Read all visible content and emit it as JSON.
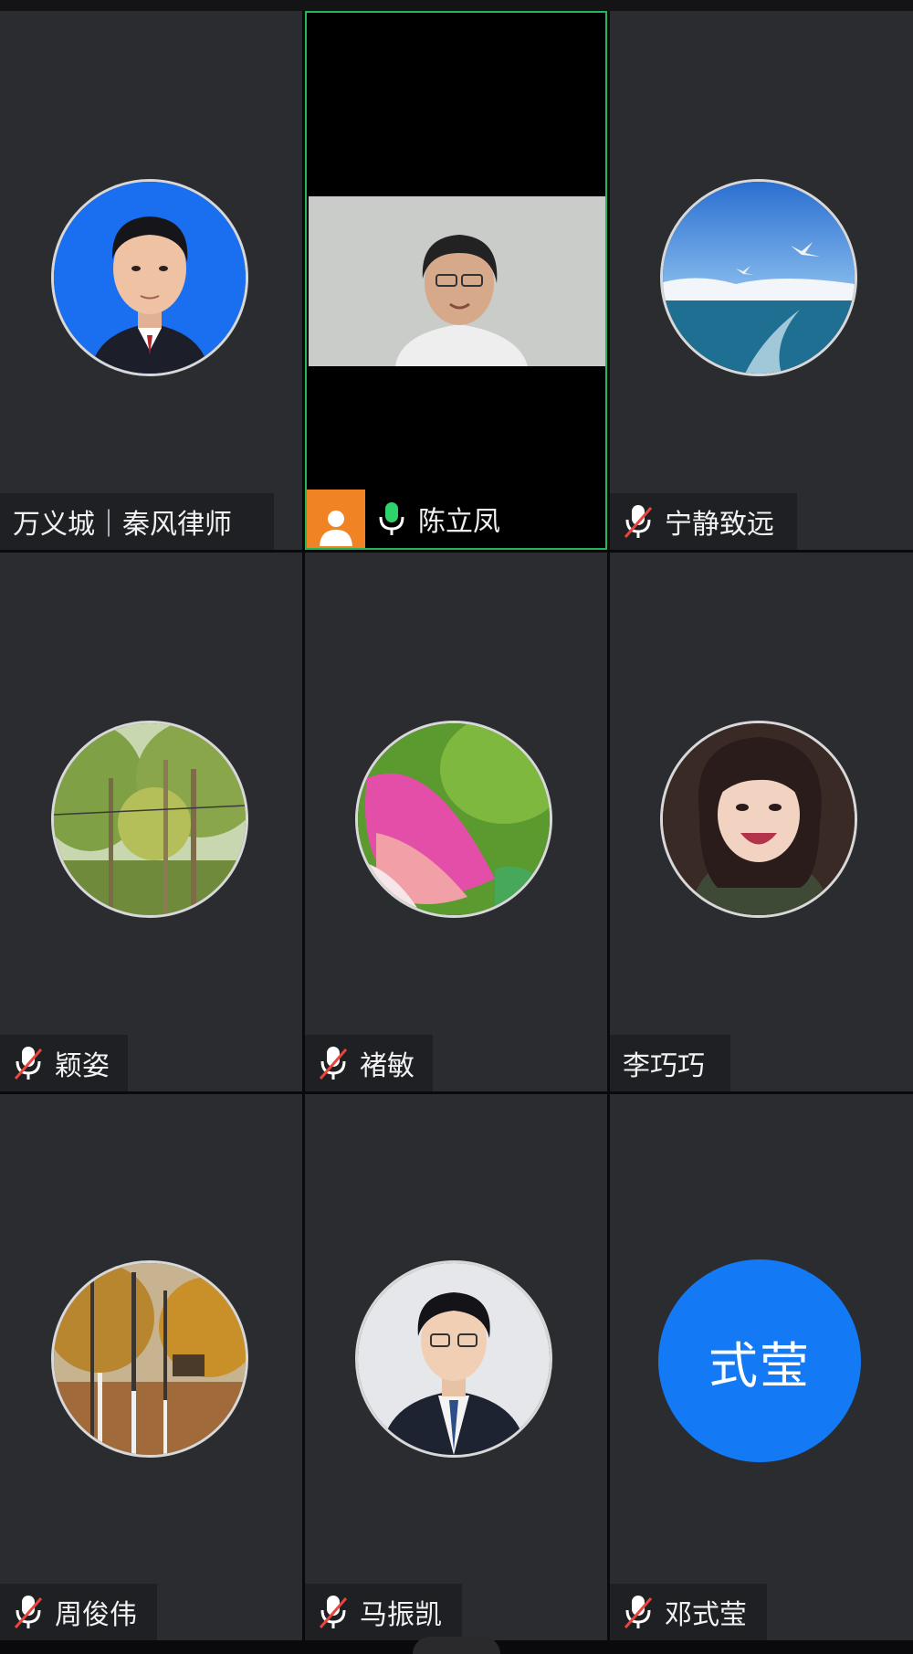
{
  "participants": [
    {
      "name": "万义城｜秦风律师",
      "mic": "none",
      "avatar": "photo-man-blue-background"
    },
    {
      "name": "陈立凤",
      "mic": "on",
      "avatar": "live-video",
      "host": true
    },
    {
      "name": "宁静致远",
      "mic": "muted",
      "avatar": "photo-seagulls-sea"
    },
    {
      "name": "颖姿",
      "mic": "muted",
      "avatar": "photo-trees"
    },
    {
      "name": "褚敏",
      "mic": "muted",
      "avatar": "photo-pink-petal"
    },
    {
      "name": "李巧巧",
      "mic": "none",
      "avatar": "photo-smiling-girl"
    },
    {
      "name": "周俊伟",
      "mic": "muted",
      "avatar": "photo-autumn-forest"
    },
    {
      "name": "马振凯",
      "mic": "muted",
      "avatar": "photo-man-suit"
    },
    {
      "name": "邓式莹",
      "mic": "muted",
      "avatar": "text-avatar",
      "avatar_text": "式莹"
    }
  ],
  "colors": {
    "tile_bg": "#2a2c30",
    "active_border": "#26b35a",
    "mic_on": "#2fd36b",
    "muted_slash": "#e8453c",
    "host_badge": "#f08323",
    "text_avatar_bg": "#1479f5"
  }
}
